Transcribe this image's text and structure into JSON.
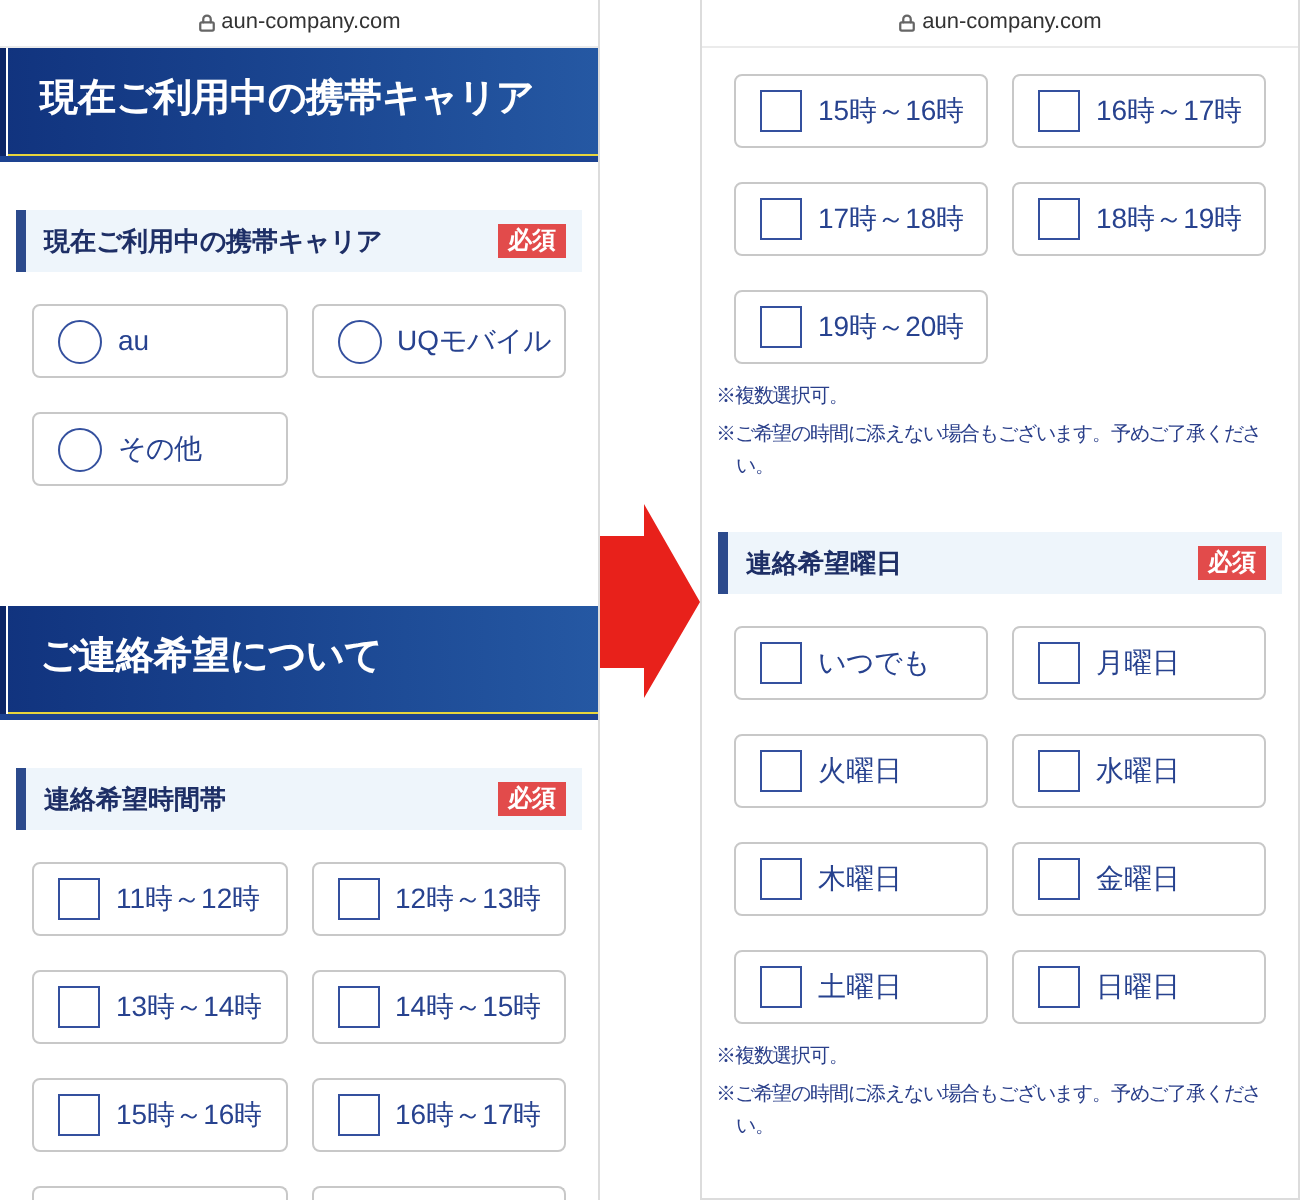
{
  "screens": [
    {
      "address_bar": {
        "url": "aun-company.com"
      },
      "blocks": [
        {
          "kind": "banner",
          "title": "現在ご利用中の携帯キャリア"
        },
        {
          "kind": "field_header",
          "label": "現在ご利用中の携帯キャリア",
          "badge": "必須"
        },
        {
          "kind": "radio_group",
          "options": [
            {
              "label": "au",
              "selected": false
            },
            {
              "label": "UQモバイル",
              "selected": false
            },
            {
              "label": "その他",
              "selected": false
            }
          ]
        },
        {
          "kind": "banner",
          "title": "ご連絡希望について"
        },
        {
          "kind": "field_header",
          "label": "連絡希望時間帯",
          "badge": "必須"
        },
        {
          "kind": "checkbox_group",
          "more_below": true,
          "options": [
            {
              "label": "11時～12時",
              "checked": false
            },
            {
              "label": "12時～13時",
              "checked": false
            },
            {
              "label": "13時～14時",
              "checked": false
            },
            {
              "label": "14時～15時",
              "checked": false
            },
            {
              "label": "15時～16時",
              "checked": false
            },
            {
              "label": "16時～17時",
              "checked": false
            }
          ]
        }
      ]
    },
    {
      "address_bar": {
        "url": "aun-company.com"
      },
      "blocks": [
        {
          "kind": "checkbox_group",
          "options": [
            {
              "label": "15時～16時",
              "checked": false
            },
            {
              "label": "16時～17時",
              "checked": false
            },
            {
              "label": "17時～18時",
              "checked": false
            },
            {
              "label": "18時～19時",
              "checked": false
            },
            {
              "label": "19時～20時",
              "checked": false
            }
          ]
        },
        {
          "kind": "notes",
          "lines": [
            "※複数選択可。",
            "※ご希望の時間に添えない場合もございます。予めご了承ください。"
          ]
        },
        {
          "kind": "field_header",
          "label": "連絡希望曜日",
          "badge": "必須"
        },
        {
          "kind": "checkbox_group",
          "options": [
            {
              "label": "いつでも",
              "checked": false
            },
            {
              "label": "月曜日",
              "checked": false
            },
            {
              "label": "火曜日",
              "checked": false
            },
            {
              "label": "水曜日",
              "checked": false
            },
            {
              "label": "木曜日",
              "checked": false
            },
            {
              "label": "金曜日",
              "checked": false
            },
            {
              "label": "土曜日",
              "checked": false
            },
            {
              "label": "日曜日",
              "checked": false
            }
          ]
        },
        {
          "kind": "notes",
          "lines": [
            "※複数選択可。",
            "※ご希望の時間に添えない場合もございます。予めご了承ください。"
          ]
        }
      ]
    }
  ]
}
